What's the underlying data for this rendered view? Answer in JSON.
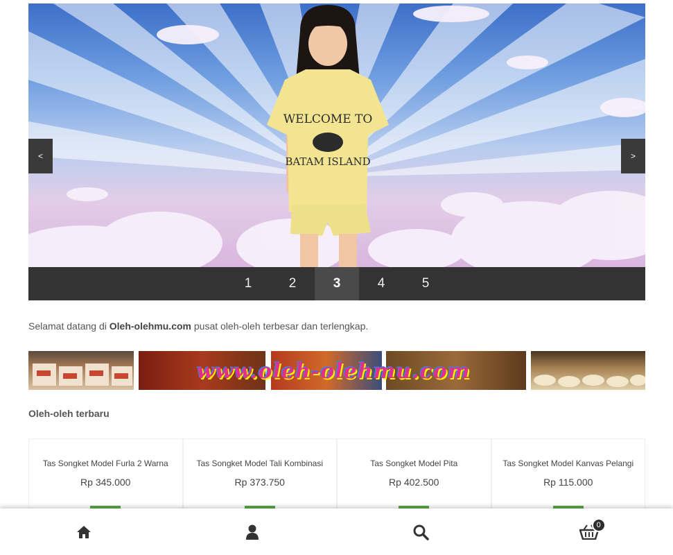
{
  "slider": {
    "prev_label": "<",
    "next_label": ">",
    "pages": [
      "1",
      "2",
      "3",
      "4",
      "5"
    ],
    "active_page": 2,
    "shirt_text": [
      "WELCOME TO",
      "BATAM ISLAND"
    ]
  },
  "welcome": {
    "prefix": "Selamat datang di ",
    "brand": "Oleh-olehmu.com",
    "suffix": " pusat oleh-oleh terbesar dan terlengkap."
  },
  "banner": {
    "text": "www.oleh-olehmu.com"
  },
  "latest": {
    "title": "Oleh-oleh terbaru",
    "products": [
      {
        "name": "Tas Songket Model Furla 2 Warna",
        "price": "Rp 345.000"
      },
      {
        "name": "Tas Songket Model Tali Kombinasi",
        "price": "Rp 373.750"
      },
      {
        "name": "Tas Songket Model Pita",
        "price": "Rp 402.500"
      },
      {
        "name": "Tas Songket Model Kanvas Pelangi",
        "price": "Rp 115.000"
      }
    ]
  },
  "bottom_nav": {
    "items": [
      "home-icon",
      "user-icon",
      "search-icon",
      "cart-icon"
    ],
    "cart_count": "0"
  },
  "colors": {
    "pager_bg": "#333333",
    "accent_green": "#5aa846",
    "sky_top": "#3d6fc9"
  }
}
